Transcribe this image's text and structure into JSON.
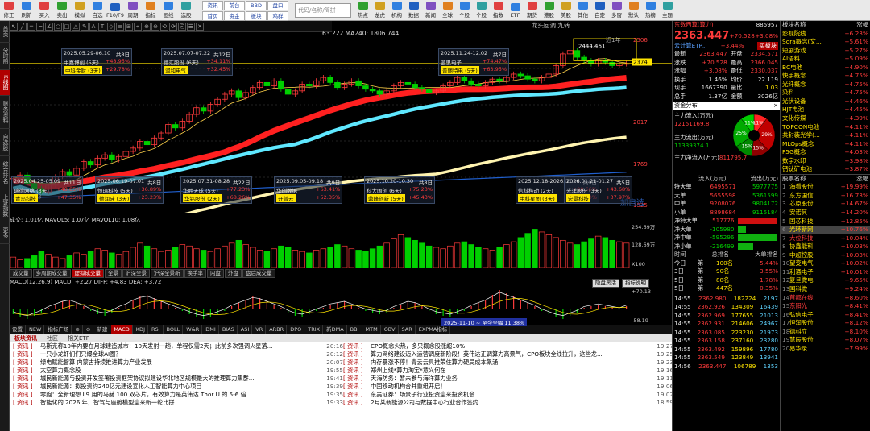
{
  "toolbar": {
    "left_buttons": [
      "修正",
      "刷新",
      "买入",
      "卖出",
      "模拟",
      "自选",
      "F10/F9",
      "周期",
      "指标",
      "画线",
      "选股"
    ],
    "tabs": [
      "资讯",
      "前台",
      "BBD",
      "盘口",
      "首页",
      "资金",
      "板块",
      "鸡群"
    ],
    "search_placeholder": "代码/名称/简拼",
    "right_buttons": [
      "热点",
      "龙虎",
      "机构",
      "数据",
      "新闻",
      "全球",
      "个股",
      "个股",
      "指数",
      "ETF",
      "期货",
      "港股",
      "美股",
      "其他",
      "自定",
      "多窗",
      "默认",
      "热榜",
      "主题"
    ]
  },
  "leftnav": [
    "首页",
    "分时图",
    "K线图",
    "财务资料",
    "自选股",
    "综合排名",
    "上证指数",
    "更多"
  ],
  "chart": {
    "ma_line": "63.222  MA240: 1806.744",
    "title_right": "龙头回调  九转",
    "price_labels": [
      "2506",
      "2374",
      "2017",
      "1769",
      "1525"
    ],
    "high_label": "2444.461",
    "low_label": "1598.823",
    "period_label": "近1年",
    "top_boxes": [
      {
        "date": "2025.05.29-06.10",
        "days": "共8日",
        "items": [
          {
            "n": "中嘉博创 (5天)",
            "v": "+48.95%"
          },
          {
            "n": "中科金财 (3天)",
            "v": "+29.78%"
          }
        ]
      },
      {
        "date": "2025.07.07-07.22",
        "days": "共12日",
        "items": [
          {
            "n": "德汇股份 (6天)",
            "v": "+34.11%"
          },
          {
            "n": "润和电气",
            "v": "+32.45%"
          }
        ]
      },
      {
        "date": "2025.11.24-12.02",
        "days": "共7日",
        "items": [
          {
            "n": "蓝思电子",
            "v": "+74.47%"
          },
          {
            "n": "普丽特电 (5天)",
            "v": "+63.95%"
          }
        ]
      }
    ],
    "bottom_boxes": [
      {
        "date": "2025.04.25-05.09",
        "days": "共11日",
        "items": [
          {
            "n": "瑞德网络 (3天)",
            "v": "+48.85%"
          },
          {
            "n": "青岛科技",
            "v": "+47.35%"
          }
        ]
      },
      {
        "date": "2025.06.19-07.01",
        "days": "共8日",
        "items": [
          {
            "n": "恒瑞科技 (5天)",
            "v": "+36.89%"
          },
          {
            "n": "德润硅 (3天)",
            "v": "+23.23%"
          }
        ]
      },
      {
        "date": "2025.07.31-08.28",
        "days": "共22日",
        "items": [
          {
            "n": "华胜天成 (5天)",
            "v": "+77.23%"
          },
          {
            "n": "华铭股份 (2天)",
            "v": "+68.26%"
          }
        ]
      },
      {
        "date": "2025.09.05-09.18",
        "days": "共9日",
        "items": [
          {
            "n": "华创数据",
            "v": "+63.41%"
          },
          {
            "n": "开普云",
            "v": "+52.35%"
          }
        ]
      },
      {
        "date": "2025.10.20-10.30",
        "days": "共8日",
        "items": [
          {
            "n": "科大国创 (6天)",
            "v": "+75.23%"
          },
          {
            "n": "鼎峰创新 (5天)",
            "v": "+45.43%"
          }
        ]
      },
      {
        "date": "2025.12.18-2026.01.06",
        "days": "共9日",
        "items": [
          {
            "n": "信科移动 (2天)",
            "v": "+88.66%"
          },
          {
            "n": "中科星图 (3天)",
            "v": "+70.30%"
          }
        ]
      },
      {
        "date": "2026.01.21-01.27",
        "days": "共5日",
        "items": [
          {
            "n": "光洋股份 (3天)",
            "v": "+43.68%"
          },
          {
            "n": "宏景科技",
            "v": "+37.97%"
          }
        ]
      }
    ],
    "watermark": "加自选",
    "candles": [
      1680,
      1700,
      1650,
      1620,
      1600,
      1640,
      1690,
      1720,
      1700,
      1740,
      1780,
      1760,
      1800,
      1820,
      1790,
      1810,
      1840,
      1860,
      1900,
      1880,
      1920,
      1950,
      2000,
      1980,
      2020,
      2060,
      2100,
      2080,
      2120,
      2150,
      2180,
      2200,
      2160,
      2190,
      2220,
      2250,
      2230,
      2260,
      2210,
      2180,
      2200,
      2240,
      2230,
      2260,
      2280,
      2250,
      2220,
      2240,
      2260,
      2230,
      2210,
      2200,
      2180,
      2200,
      2230,
      2250,
      2240,
      2220,
      2210,
      2190,
      2200,
      2230,
      2250,
      2280,
      2260,
      2240,
      2230,
      2250,
      2270,
      2260,
      2280,
      2300,
      2290,
      2270,
      2260,
      2280,
      2300,
      2350,
      2420,
      2440,
      2400,
      2380,
      2360,
      2380,
      2370,
      2350,
      2360,
      2363
    ]
  },
  "volume": {
    "label": "成交: 1.01亿  MAVOL5: 1.07亿  MAVOL10: 1.08亿",
    "axis": [
      "254.69万",
      "128.69万",
      "X100"
    ],
    "bars": [
      8,
      6,
      7,
      9,
      12,
      10,
      8,
      7,
      9,
      11,
      10,
      12,
      14,
      13,
      11,
      10,
      12,
      15,
      18,
      16,
      14,
      12,
      13,
      15,
      17,
      16,
      14,
      13,
      12,
      14,
      16,
      18,
      20,
      17,
      15,
      13,
      12,
      14,
      16,
      15,
      13,
      12,
      11,
      13,
      14,
      15,
      17,
      16,
      14,
      13,
      12,
      14,
      16,
      18,
      21,
      24,
      22,
      20,
      18,
      16,
      15,
      14,
      16,
      18,
      19,
      17,
      15,
      14,
      13,
      15,
      17,
      19,
      22,
      25,
      28,
      26,
      24,
      22,
      20,
      18,
      17,
      19,
      21,
      23,
      22,
      20,
      19,
      18
    ]
  },
  "subtabs": [
    "成交量",
    "多周期成交量",
    "虚拟成交量",
    "全景",
    "沪深全景",
    "沪深全景新",
    "换手率",
    "内盘",
    "外盘",
    "盘后成交量"
  ],
  "macd": {
    "label": "MACD(12,26,9)  MACD: +2.27  DIFF: +4.83  DEA: +3.72",
    "axis": [
      "+70.13",
      "-58.19"
    ],
    "btns": [
      "隐盘灵活",
      "指标说明"
    ],
    "bars": [
      -3,
      -5,
      -6,
      -4,
      -2,
      1,
      3,
      5,
      6,
      4,
      2,
      -1,
      -3,
      -4,
      -2,
      1,
      3,
      6,
      8,
      9,
      7,
      5,
      3,
      1,
      -1,
      -3,
      -5,
      -6,
      -5,
      -3,
      -1,
      2,
      4,
      6,
      8,
      7,
      5,
      3,
      1,
      -2,
      -4,
      -5,
      -3,
      -1,
      1,
      3,
      4,
      5,
      3,
      1,
      -1,
      -2,
      -3,
      -2,
      1,
      3,
      5,
      4,
      2,
      -1,
      -3,
      -4,
      -5,
      -3,
      -1,
      2,
      4,
      6,
      9,
      12,
      10,
      8,
      6,
      4,
      2,
      -1,
      -3,
      -5,
      -6,
      -4,
      -2,
      1,
      2,
      3,
      2,
      1,
      0,
      2
    ]
  },
  "indicators": [
    "设置",
    "NEW",
    "指标广场",
    "⊕",
    "⊖",
    "新建",
    "MACD",
    "KDJ",
    "RSI",
    "BOLL",
    "W&R",
    "DMI",
    "BIAS",
    "ASI",
    "VR",
    "ARBR",
    "DPO",
    "TRIX",
    "新DMA",
    "BBI",
    "MTM",
    "OBV",
    "SAR",
    "EXPMA指标"
  ],
  "timeline": "2025-11-10 ~ 至今全幅 11.38%",
  "news_tabs": [
    "板块资讯",
    "社区",
    "相关ETF"
  ],
  "news_left": [
    {
      "tag": "[ 资讯 ]",
      "title": "马斯克称10年内要在月球建造城市：10天发射一趟，单程仅需2天；此前多次强调火星落...",
      "time": "20:16"
    },
    {
      "tag": "[ 资讯 ]",
      "title": "一只小龙虾们们只爆全球AI圈？",
      "time": "20:12"
    },
    {
      "tag": "[ 资讯 ]",
      "title": "绿电赋能智算 内蒙古持续推进算力产业发展",
      "time": "20:07"
    },
    {
      "tag": "[ 资讯 ]",
      "title": "太空算力概念股",
      "time": "19:55"
    },
    {
      "tag": "[ 资讯 ]",
      "title": "城民新能源与投资开发签署投资框架协议拟建设华北地区规模最大的推理算力集群...",
      "time": "19:41"
    },
    {
      "tag": "[ 资讯 ]",
      "title": "城民新能源：拟投资约240亿元建设宣化人工智能算力中心项目",
      "time": "19:39"
    },
    {
      "tag": "[ 资讯 ]",
      "title": "零跑：全新理想 L9 用的马赫 100 双芯片，有效算力是英伟达 Thor U 的 5-6 倍",
      "time": "19:35"
    },
    {
      "tag": "[ 资讯 ]",
      "title": "智能化的 2026 年，智驾与座舱模型迎来新一轮比拼...",
      "time": "19:33"
    }
  ],
  "news_right": [
    {
      "tag": "[ 资讯 ]",
      "title": "CPO概念火热，多只概念股涨超10%",
      "time": "19:27"
    },
    {
      "tag": "[ 资讯 ]",
      "title": "算力网络建设迈入运营调度新阶段！英伟达正调算力高景气，CPO板块全线拉升，这些龙...",
      "time": "19:25"
    },
    {
      "tag": "[ 资讯 ]",
      "title": "内存暴涨不停！青云云具推荣住算力硬局成本飙涌",
      "time": "19:23"
    },
    {
      "tag": "[ 资讯 ]",
      "title": "郑州上线*算力淘宝*意义何在",
      "time": "19:16"
    },
    {
      "tag": "[ 资讯 ]",
      "title": "天海防务：暂未参与海洋算力业务",
      "time": "19:11"
    },
    {
      "tag": "[ 资讯 ]",
      "title": "中国移动机构合并重组开启！",
      "time": "19:06"
    },
    {
      "tag": "[ 资讯 ]",
      "title": "东吴证券：场景子行业投资迎来投资机会",
      "time": "19:02"
    },
    {
      "tag": "[ 资讯 ]",
      "title": "2月某新能源公司与数据中心行业合作签约...",
      "time": "18:59"
    }
  ],
  "quote": {
    "name": "东数西算(算力)",
    "code": "885957",
    "price": "2363.447",
    "change": "+70.528",
    "pct": "+3.08%",
    "sub_left": "云计算ETP...",
    "sub_pct": "+3.44%",
    "sub_btn": "买板块",
    "fields": [
      [
        "最新",
        "2363.447",
        "red",
        "开盘",
        "2334.571",
        "red"
      ],
      [
        "涨跌",
        "+70.528",
        "red",
        "最高",
        "2366.045",
        "red"
      ],
      [
        "涨幅",
        "+3.08%",
        "red",
        "最低",
        "2330.037",
        "red"
      ],
      [
        "换手",
        "1.46%",
        "wht",
        "均价",
        "22.119",
        "wht"
      ],
      [
        "现手",
        "1667390",
        "wht",
        "量比",
        "1.03",
        "yel"
      ],
      [
        "总手",
        "1.37亿",
        "wht",
        "金额",
        "3026亿",
        "wht"
      ]
    ],
    "fund_title": "资金分布",
    "inflow_label": "主力流入(万元)",
    "inflow": "12151169.8",
    "outflow_label": "主力流出(万元)",
    "outflow": "11339374.1",
    "net_label": "主力净流入(万元)",
    "net": "811795.7",
    "pie": [
      {
        "v": 11,
        "c": "#ff2222"
      },
      {
        "v": 29,
        "c": "#c00000"
      },
      {
        "v": 15,
        "c": "#900000"
      },
      {
        "v": 15,
        "c": "#008800"
      },
      {
        "v": 25,
        "c": "#00aa00"
      },
      {
        "v": 11,
        "c": "#00cc00"
      }
    ],
    "pie_labels": [
      "11%",
      "29%",
      "15%",
      "15%",
      "25%",
      "11%"
    ],
    "flow_head": [
      "",
      "流入(万元)",
      "流出(万元)"
    ],
    "flow_rows": [
      [
        "特大单",
        "6495571",
        "5977775"
      ],
      [
        "大单",
        "5655598",
        "5361599"
      ],
      [
        "中单",
        "9208076",
        "9804172"
      ],
      [
        "小单",
        "8898684",
        "9115184"
      ]
    ],
    "net_rows": [
      {
        "k": "净特大单",
        "v": "517776",
        "p": 1.0
      },
      {
        "k": "净大单",
        "v": "-105980",
        "p": -0.2
      },
      {
        "k": "净中单",
        "v": "-595296",
        "p": -1.0
      },
      {
        "k": "净小单",
        "v": "-216499",
        "p": -0.4
      }
    ],
    "rank_head": [
      "时间",
      "总排名",
      "大单排名"
    ],
    "rank_rows": [
      [
        "今日",
        "第",
        "100名",
        "5.44%"
      ],
      [
        "3日",
        "第",
        "90名",
        "3.55%"
      ],
      [
        "5日",
        "第",
        "88名",
        "1.78%"
      ],
      [
        "5日",
        "第",
        "447名",
        "0.35%"
      ]
    ],
    "ticks": [
      [
        "14:55",
        "2362.980",
        "182224",
        "2197"
      ],
      [
        "14:55",
        "2362.926",
        "134309",
        "16439"
      ],
      [
        "14:55",
        "2362.969",
        "177655",
        "21013"
      ],
      [
        "14:55",
        "2362.931",
        "214606",
        "24967"
      ],
      [
        "14:55",
        "2363.085",
        "223230",
        "21973"
      ],
      [
        "14:55",
        "2363.158",
        "237160",
        "23280"
      ],
      [
        "14:55",
        "2363.492",
        "159896",
        "17780"
      ],
      [
        "14:55",
        "2363.549",
        "123849",
        "13941"
      ],
      [
        "14:56",
        "2363.447",
        "106789",
        "1353"
      ]
    ]
  },
  "sectors": {
    "head": [
      "板块名称",
      "涨幅"
    ],
    "list": [
      [
        "影视院线",
        "+6.23%"
      ],
      [
        "Sora概念(文...",
        "+5.61%"
      ],
      [
        "短剧游戏",
        "+5.27%"
      ],
      [
        "AI语料",
        "+5.09%"
      ],
      [
        "BC电池",
        "+4.90%"
      ],
      [
        "快手概念",
        "+4.75%"
      ],
      [
        "光纤概念",
        "+4.75%"
      ],
      [
        "染料",
        "+4.75%"
      ],
      [
        "光伏设备",
        "+4.46%"
      ],
      [
        "HJT电池",
        "+4.45%"
      ],
      [
        "文化传媒",
        "+4.39%"
      ],
      [
        "TOPCON电池",
        "+4.11%"
      ],
      [
        "共封装光学(...",
        "+4.11%"
      ],
      [
        "MLOps概念",
        "+4.11%"
      ],
      [
        "F5G概念",
        "+4.03%"
      ],
      [
        "数字水印",
        "+3.98%"
      ],
      [
        "钙钛矿电池",
        "+3.87%"
      ]
    ],
    "stock_head": [
      "股票名称",
      "涨幅"
    ],
    "stocks": [
      [
        "1",
        "海看股份",
        "+19.99%"
      ],
      [
        "2",
        "东方国信",
        "+16.73%"
      ],
      [
        "3",
        "芯原股份",
        "+14.67%"
      ],
      [
        "4",
        "安诺其",
        "+14.20%"
      ],
      [
        "5",
        "国芯科技",
        "+12.85%"
      ],
      [
        "6",
        "光环新网",
        "+10.76%"
      ],
      [
        "7",
        "大位科技",
        "+10.04%"
      ],
      [
        "8",
        "协鑫能科",
        "+10.03%"
      ],
      [
        "9",
        "中超控股",
        "+10.03%"
      ],
      [
        "10",
        "望变电气",
        "+10.02%"
      ],
      [
        "11",
        "利通电子",
        "+10.01%"
      ],
      [
        "12",
        "复旦微电",
        "+9.65%"
      ],
      [
        "13",
        "国科微",
        "+9.24%"
      ],
      [
        "14",
        "首都在线",
        "+8.60%"
      ],
      [
        "15",
        "东阳光",
        "+8.41%"
      ],
      [
        "16",
        "弘信电子",
        "+8.41%"
      ],
      [
        "17",
        "恒润股份",
        "+8.12%"
      ],
      [
        "18",
        "德科立",
        "+8.10%"
      ],
      [
        "19",
        "慧辰股份",
        "+8.07%"
      ],
      [
        "20",
        "易华录",
        "+7.99%"
      ]
    ]
  },
  "colors": {
    "up": "#ff3b3b",
    "down": "#00d000",
    "accent": "#b00000",
    "ma_red": "#ff2020",
    "ma_cyan": "#5fe8ff",
    "ma_cream": "#fff4b0"
  }
}
